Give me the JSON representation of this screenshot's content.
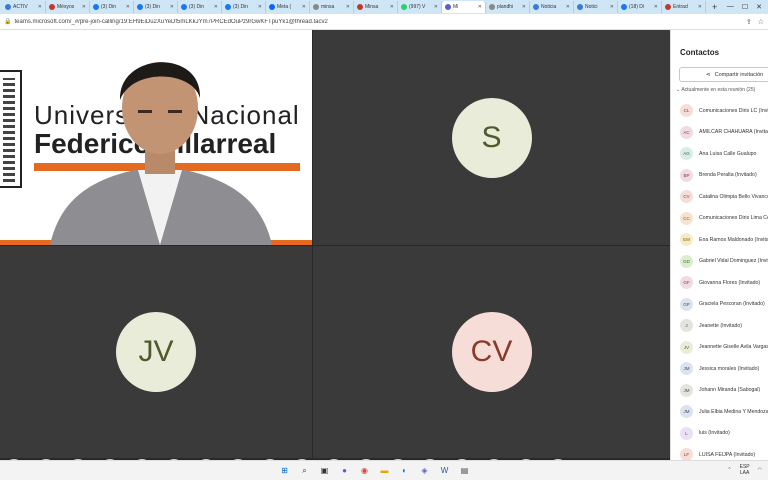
{
  "browser": {
    "tabs": [
      {
        "label": "ACTIV",
        "color": "#3a7bd5"
      },
      {
        "label": "Mésyos",
        "color": "#c0392b"
      },
      {
        "label": "(3) Din",
        "color": "#1877f2"
      },
      {
        "label": "(3) Din",
        "color": "#1877f2"
      },
      {
        "label": "(3) Din",
        "color": "#1877f2"
      },
      {
        "label": "(3) Din",
        "color": "#1877f2"
      },
      {
        "label": "Meta (",
        "color": "#0866ff"
      },
      {
        "label": "minsa",
        "color": "#888888"
      },
      {
        "label": "Minsa",
        "color": "#c0392b"
      },
      {
        "label": "(997) V",
        "color": "#25d366"
      },
      {
        "label": "Mi",
        "color": "#5b5fc7",
        "active": true
      },
      {
        "label": "plandhi",
        "color": "#888888"
      },
      {
        "label": "Noticia",
        "color": "#3a7bd5"
      },
      {
        "label": "Notici",
        "color": "#3a7bd5"
      },
      {
        "label": "(18) Di",
        "color": "#1877f2"
      },
      {
        "label": "Entrad",
        "color": "#c0392b"
      }
    ],
    "new_tab": "+",
    "url": "teams.microsoft.com/_#/pre-join-calling/19:EH9EiDu2XuYeDf5mLKkJYm7PRCEdOuPz9rGwKFTpuYk1@thread.tacv2"
  },
  "stage": {
    "video": {
      "line1": "Universidad Nacional",
      "line2": "Federico Villarreal"
    },
    "tiles": [
      {
        "initials": "S",
        "bg": "#e8ecd8",
        "fg": "#4e5a2e"
      },
      {
        "initials": "JV",
        "bg": "#e8ecd8",
        "fg": "#4e5a2e"
      },
      {
        "initials": "CV",
        "bg": "#f6ddd8",
        "fg": "#8a3a2a"
      }
    ],
    "strip": [
      {
        "initials": "RP",
        "bg": "#dde3ee",
        "fg": "#3b4a66"
      },
      {
        "initials": "JM",
        "bg": "#dde3ee",
        "fg": "#3b4a66"
      },
      {
        "initials": "JM",
        "bg": "#dde3ee",
        "fg": "#3b4a66"
      },
      {
        "initials": "BP",
        "bg": "#f1dbe3",
        "fg": "#7a3550"
      },
      {
        "initials": "MD",
        "bg": "#f6ddd8",
        "fg": "#8a3a2a"
      },
      {
        "initials": "L",
        "bg": "#e9e1f3",
        "fg": "#5a3f80"
      },
      {
        "initials": "VJ",
        "bg": "#f5ecc7",
        "fg": "#7a6414"
      },
      {
        "initials": "AG",
        "bg": "#d8ece8",
        "fg": "#2f6a5e"
      },
      {
        "initials": "MC",
        "bg": "#f6e3cf",
        "fg": "#8a5220"
      },
      {
        "initials": "SQ",
        "bg": "#dde3ee",
        "fg": "#3b4a66"
      },
      {
        "initials": "GD",
        "bg": "#dbeccf",
        "fg": "#3f6a24"
      },
      {
        "initials": "JM",
        "bg": "#e4e4de",
        "fg": "#4d4d40"
      },
      {
        "initials": "PC",
        "bg": "#e4e4de",
        "fg": "#4d4d40"
      },
      {
        "initials": "YV",
        "bg": "#dde3ee",
        "fg": "#3b4a66"
      },
      {
        "initials": "EM",
        "bg": "#f5ecc7",
        "fg": "#7a6414"
      },
      {
        "initials": "GF",
        "bg": "#f1dbe3",
        "fg": "#7a3550"
      },
      {
        "initials": "CC",
        "bg": "#f6e3cf",
        "fg": "#8a5220"
      },
      {
        "initials": "PA",
        "bg": "#f6ddd8",
        "fg": "#8a3a2a"
      }
    ]
  },
  "panel": {
    "title": "Contactos",
    "share_label": "Compartir invitación",
    "section_label": "Actualmente en esta reunión (25)",
    "people": [
      {
        "initials": "CL",
        "name": "Comunicaciones Diris LC (Invitado)",
        "bg": "#f6ddd8",
        "fg": "#8a3a2a"
      },
      {
        "initials": "AC",
        "name": "AMILCAR CHAHUARA (Invitado)",
        "bg": "#f1dbe3",
        "fg": "#7a3550"
      },
      {
        "initials": "AG",
        "name": "Ana Luisa Calle Gualupo",
        "bg": "#d8ece8",
        "fg": "#2f6a5e"
      },
      {
        "initials": "BP",
        "name": "Brenda Peralta (Invitado)",
        "bg": "#f1dbe3",
        "fg": "#7a3550"
      },
      {
        "initials": "CV",
        "name": "Catalina Olimpia Bello Vivanco",
        "bg": "#f6ddd8",
        "fg": "#8a3a2a"
      },
      {
        "initials": "CC",
        "name": "Comunicaciones Diris Lima Centro",
        "bg": "#f6e3cf",
        "fg": "#8a5220"
      },
      {
        "initials": "EM",
        "name": "Ena Ramos Maldonado (Invitado)",
        "bg": "#f5ecc7",
        "fg": "#7a6414"
      },
      {
        "initials": "GD",
        "name": "Gabriel Vidal Dominguez (Invitado)",
        "bg": "#dbeccf",
        "fg": "#3f6a24"
      },
      {
        "initials": "GF",
        "name": "Giovanna Flores (Invitado)",
        "bg": "#f1dbe3",
        "fg": "#7a3550"
      },
      {
        "initials": "GP",
        "name": "Graciela Pescoran (Invitado)",
        "bg": "#dde3ee",
        "fg": "#3b4a66"
      },
      {
        "initials": "J",
        "name": "Jeanette (Invitado)",
        "bg": "#e4e4de",
        "fg": "#4d4d40"
      },
      {
        "initials": "JV",
        "name": "Jeannette Giselle Avila Vargas",
        "bg": "#e8ecd8",
        "fg": "#4e5a2e"
      },
      {
        "initials": "JM",
        "name": "Jessica morales (Invitado)",
        "bg": "#dde3ee",
        "fg": "#3b4a66"
      },
      {
        "initials": "JM",
        "name": "Johann Miranda (Sabogal)",
        "bg": "#e4e4de",
        "fg": "#4d4d40"
      },
      {
        "initials": "JM",
        "name": "Julia Elbia Medina Y Mendoza",
        "bg": "#dde3ee",
        "fg": "#3b4a66"
      },
      {
        "initials": "L",
        "name": "luis (Invitado)",
        "bg": "#e9e1f3",
        "fg": "#5a3f80"
      },
      {
        "initials": "LF",
        "name": "LUISA FEIJPA (Invitado)",
        "bg": "#f6ddd8",
        "fg": "#8a3a2a"
      }
    ]
  },
  "taskbar": {
    "lang_top": "ESP",
    "lang_bottom": "LAA"
  }
}
